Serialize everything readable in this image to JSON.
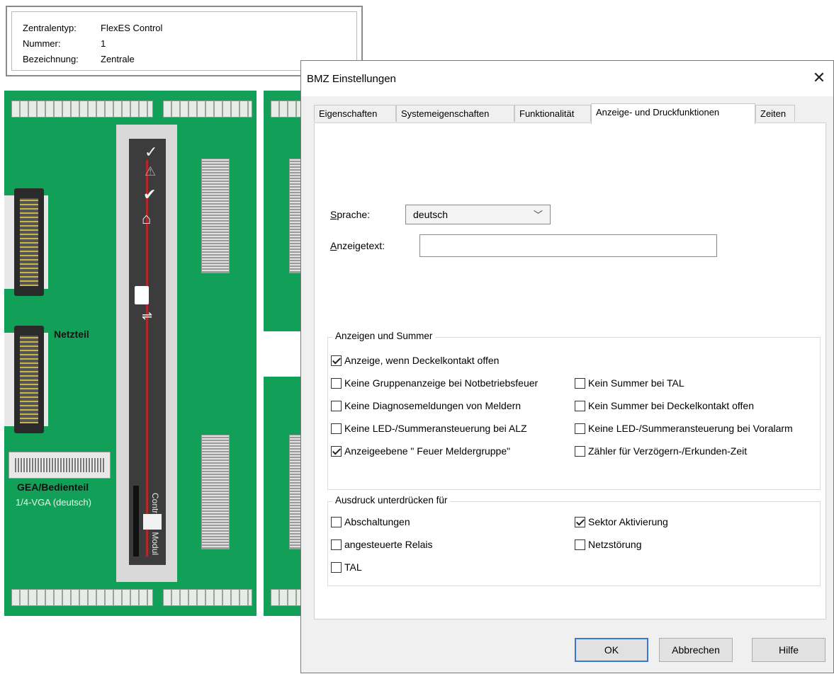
{
  "info": {
    "rows": [
      {
        "key": "Zentralentyp:",
        "value": "FlexES Control"
      },
      {
        "key": "Nummer:",
        "value": "1"
      },
      {
        "key": "Bezeichnung:",
        "value": "Zentrale"
      }
    ]
  },
  "board": {
    "netzteil_label": "Netzteil",
    "gea_label": "GEA/Bedienteil",
    "gea_sub": "1/4-VGA (deutsch)",
    "controller_label": "Controller Modul",
    "controller_icons": [
      "check-icon",
      "warning-icon",
      "check-circle-icon",
      "house-icon",
      "usb-icon",
      "ethernet-icon"
    ]
  },
  "dialog": {
    "title": "BMZ Einstellungen",
    "close": "✕",
    "tabs": [
      {
        "label": "Eigenschaften",
        "active": false
      },
      {
        "label": "Systemeigenschaften",
        "active": false
      },
      {
        "label": "Funktionalität",
        "active": false
      },
      {
        "label": "Anzeige- und Druckfunktionen",
        "active": true
      },
      {
        "label": "Zeiten",
        "active": false
      }
    ],
    "sprache": {
      "label_u": "S",
      "label_rest": "prache:",
      "value": "deutsch"
    },
    "anzeigetext": {
      "label_u": "A",
      "label_rest": "nzeigetext:",
      "value": ""
    },
    "group1": {
      "title": "Anzeigen und Summer",
      "items": [
        {
          "label": "Anzeige, wenn Deckelkontakt offen",
          "checked": true
        },
        {
          "label": "Keine Gruppenanzeige bei Notbetriebsfeuer",
          "checked": false
        },
        {
          "label": "Kein Summer bei TAL",
          "checked": false
        },
        {
          "label": "Keine Diagnosemeldungen von Meldern",
          "checked": false
        },
        {
          "label": "Kein Summer bei Deckelkontakt offen",
          "checked": false
        },
        {
          "label": "Keine LED-/Summeransteuerung bei ALZ",
          "checked": false
        },
        {
          "label": "Keine LED-/Summeransteuerung bei Voralarm",
          "checked": false
        },
        {
          "label": "Anzeigeebene \" Feuer Meldergruppe\"",
          "checked": true
        },
        {
          "label": "Zähler für Verzögern-/Erkunden-Zeit",
          "checked": false
        }
      ]
    },
    "group2": {
      "title": "Ausdruck unterdrücken für",
      "items": [
        {
          "label": "Abschaltungen",
          "checked": false
        },
        {
          "label": "Sektor Aktivierung",
          "checked": true
        },
        {
          "label": "angesteuerte Relais",
          "checked": false
        },
        {
          "label": "Netzstörung",
          "checked": false
        },
        {
          "label": "TAL",
          "checked": false
        }
      ]
    },
    "buttons": {
      "ok": "OK",
      "cancel": "Abbrechen",
      "help": "Hilfe"
    }
  }
}
